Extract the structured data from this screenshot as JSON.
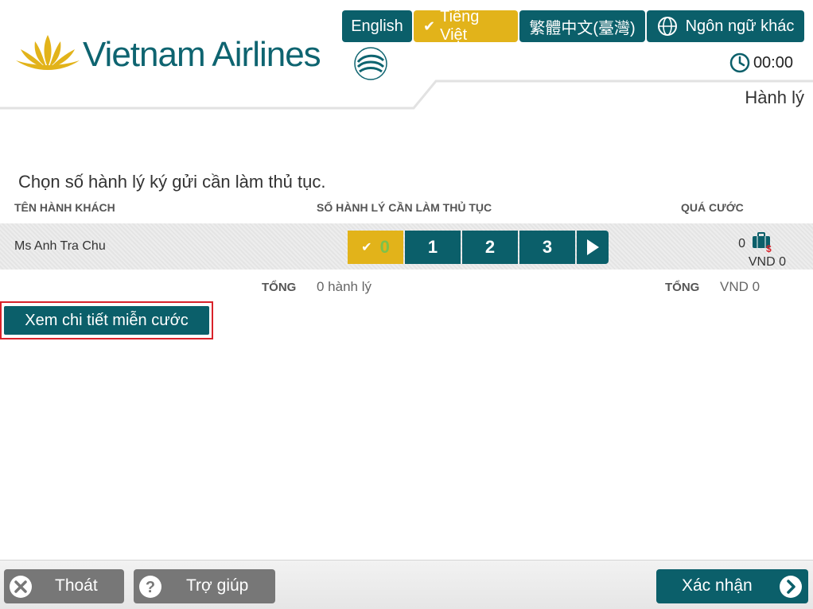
{
  "brand": {
    "name": "Vietnam Airlines"
  },
  "languages": [
    {
      "label": "English",
      "active": false
    },
    {
      "label": "Tiếng Việt",
      "active": true
    },
    {
      "label": "繁體中文(臺灣)",
      "active": false
    },
    {
      "label": "Ngôn ngữ khác",
      "active": false
    }
  ],
  "timer": "00:00",
  "page_title": "Hành lý",
  "instruction": "Chọn số hành lý ký gửi cần làm thủ tục.",
  "columns": {
    "passenger": "TÊN HÀNH KHÁCH",
    "bag_count": "SỐ HÀNH LÝ CẦN LÀM THỦ TỤC",
    "excess": "QUÁ CƯỚC"
  },
  "passenger": {
    "name": "Ms Anh Tra Chu",
    "options": [
      "0",
      "1",
      "2",
      "3"
    ],
    "selected": "0",
    "excess_count": "0",
    "excess_amount": "VND 0"
  },
  "totals": {
    "label": "TỔNG",
    "bags": "0 hành lý",
    "amount": "VND 0"
  },
  "detail_button": "Xem chi tiết miễn cước",
  "footer": {
    "exit": "Thoát",
    "help": "Trợ giúp",
    "confirm": "Xác nhận"
  },
  "colors": {
    "teal": "#0b5f6a",
    "gold": "#e2b31a",
    "highlight": "#d9222a"
  }
}
